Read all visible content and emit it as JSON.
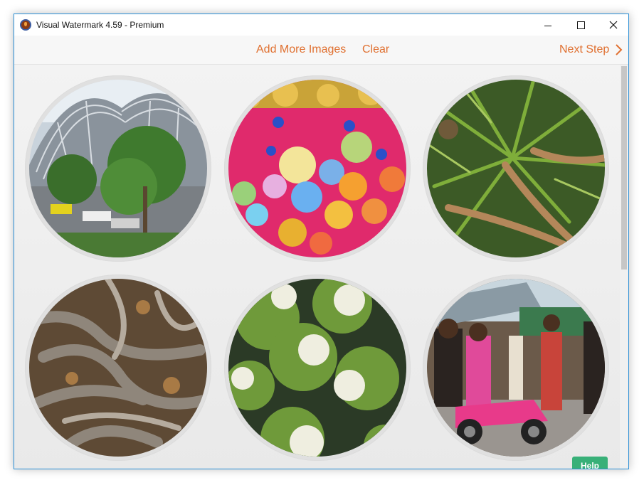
{
  "window": {
    "title": "Visual Watermark 4.59 - Premium"
  },
  "toolbar": {
    "add_more_label": "Add More Images",
    "clear_label": "Clear",
    "next_step_label": "Next Step"
  },
  "help": {
    "label": "Help"
  },
  "icons": {
    "app": "app-logo-icon",
    "minimize": "minimize-icon",
    "maximize": "maximize-icon",
    "close": "close-icon",
    "next": "chevron-right-icon"
  },
  "colors": {
    "accent": "#e07030",
    "help_button": "#38b078",
    "window_border": "#2b8fd6"
  },
  "images": [
    {
      "subject": "steel stadium roof with trees and parked cars"
    },
    {
      "subject": "colorful paper lanterns and monkey decorations"
    },
    {
      "subject": "pandan palm tree leaves"
    },
    {
      "subject": "twisted tree roots"
    },
    {
      "subject": "green coconuts in water"
    },
    {
      "subject": "people on a pink scooter at a street market"
    }
  ]
}
